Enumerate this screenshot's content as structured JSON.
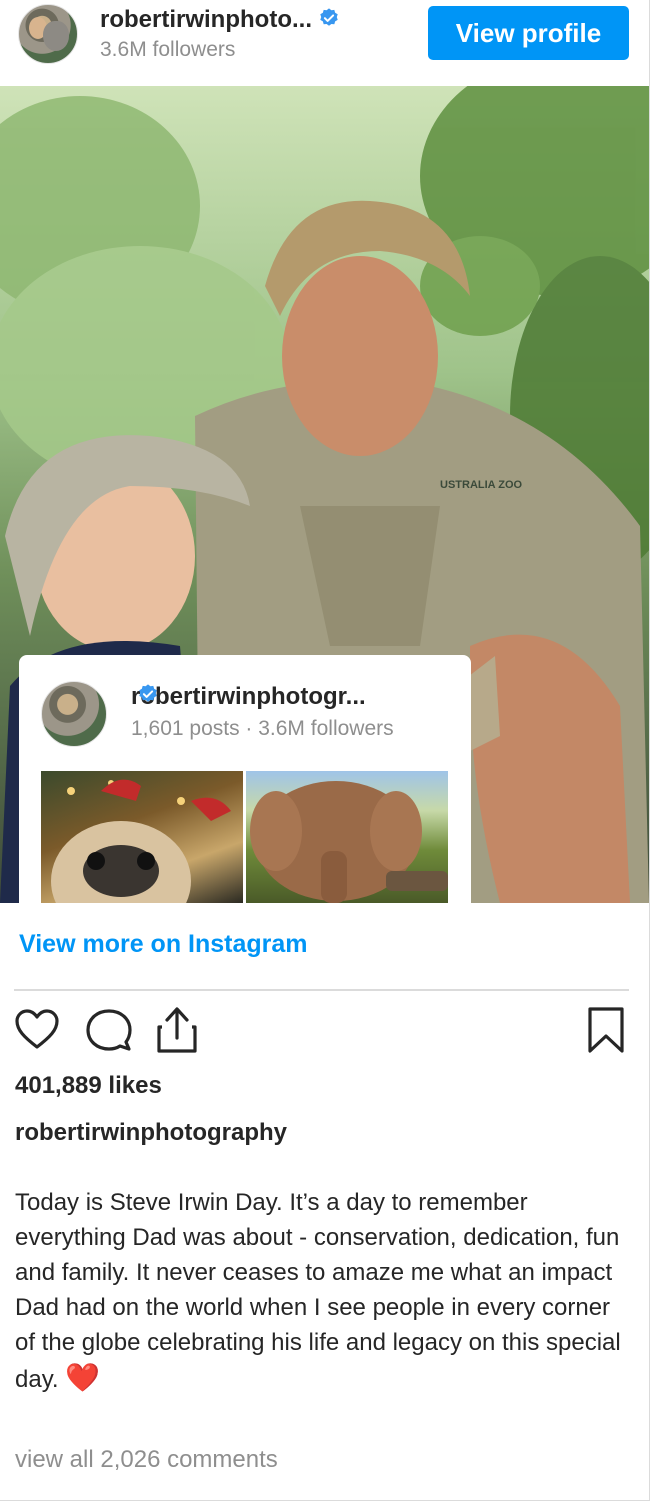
{
  "header": {
    "username_truncated": "robertirwinphoto...",
    "followers": "3.6M followers",
    "view_profile_label": "View profile"
  },
  "card": {
    "username_truncated": "robertirwinphotogr...",
    "stats": "1,601 posts · 3.6M followers"
  },
  "view_more_label": "View more on Instagram",
  "post": {
    "likes": "401,889 likes",
    "username": "robertirwinphotography",
    "caption": "Today is Steve Irwin Day. It’s a day to remember everything Dad was about - conservation, dedication, fun and family. It never ceases to amaze me what an impact Dad had on the world when I see people in every corner of the globe celebrating his life and legacy on this special day. ",
    "caption_emoji": "❤️",
    "comments_label": "view all 2,026 comments",
    "shirt_logo_text": "USTRALIA ZOO"
  },
  "icons": [
    "verified-badge-icon",
    "heart-icon",
    "comment-icon",
    "share-icon",
    "bookmark-icon"
  ],
  "colors": {
    "accent": "#0095f6",
    "secondary_text": "#8e8e8e",
    "primary_text": "#262626",
    "divider": "#dbdbdb"
  }
}
